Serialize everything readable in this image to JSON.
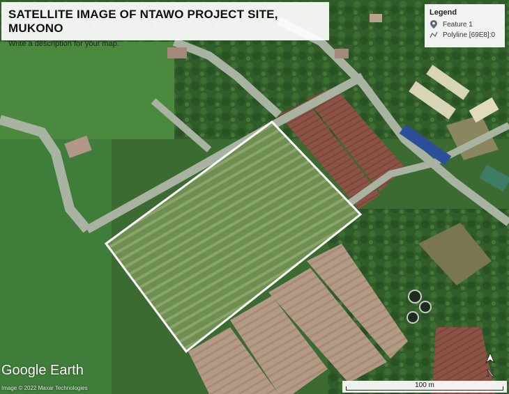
{
  "map": {
    "title": "SATELLITE IMAGE OF NTAWO PROJECT SITE, MUKONO",
    "description": "Write a description for your map.",
    "imagery_brand": "Google Earth",
    "copyright": "Image © 2022 Maxar Technologies",
    "north_label": "N",
    "boundary_color": "#ffffff"
  },
  "legend": {
    "title": "Legend",
    "items": [
      {
        "label": "Feature 1",
        "icon": "map-pin-icon"
      },
      {
        "label": "Polyline [69E8]:0",
        "icon": "polyline-icon"
      }
    ]
  },
  "scale_bar": {
    "label": "100 m"
  }
}
